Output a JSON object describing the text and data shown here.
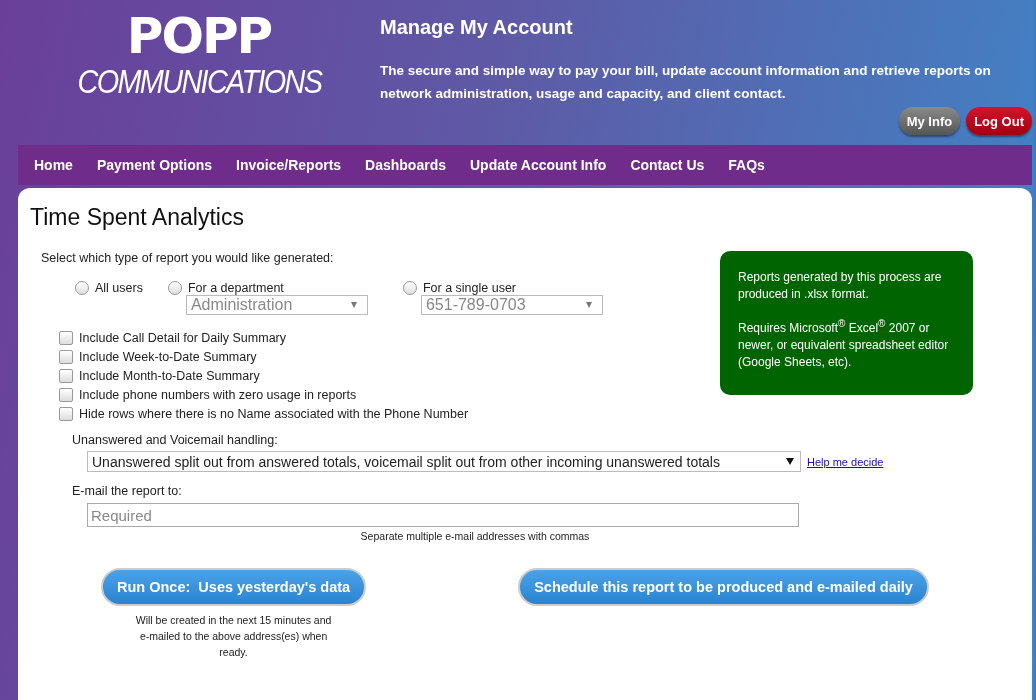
{
  "header": {
    "logo": {
      "wordmark": "POPP",
      "tagline": "COMMUNICATIONS"
    },
    "title": "Manage My Account",
    "description": "The secure and simple way to pay your bill, update account information and retrieve reports on network administration, usage and capacity, and client contact.",
    "buttons": [
      {
        "label": "My Info",
        "kind": "neutral"
      },
      {
        "label": "Log Out",
        "kind": "danger"
      }
    ]
  },
  "nav": {
    "items": [
      {
        "label": "Home"
      },
      {
        "label": "Payment Options"
      },
      {
        "label": "Invoice/Reports"
      },
      {
        "label": "Dashboards"
      },
      {
        "label": "Update Account Info"
      },
      {
        "label": "Contact Us"
      },
      {
        "label": "FAQs"
      }
    ]
  },
  "page": {
    "title": "Time Spent Analytics",
    "report_type": {
      "prompt": "Select which type of report you would like generated:",
      "options": [
        {
          "label": "All users",
          "selected": false
        },
        {
          "label": "For a department",
          "selected": false,
          "dropdown": {
            "value": "Administration",
            "disabled": true
          }
        },
        {
          "label": "For a single user",
          "selected": false,
          "dropdown": {
            "value": "651-789-0703",
            "disabled": true
          }
        }
      ]
    },
    "checkboxes": [
      {
        "label": "Include Call Detail for Daily Summary",
        "checked": false
      },
      {
        "label": "Include Week-to-Date Summary",
        "checked": false
      },
      {
        "label": "Include Month-to-Date Summary",
        "checked": false
      },
      {
        "label": "Include phone numbers with zero usage in reports",
        "checked": false
      },
      {
        "label": "Hide rows where there is no Name associated with the Phone Number",
        "checked": false
      }
    ],
    "info_box": {
      "paragraphs": [
        "Reports generated by this process are produced in .xlsx format.",
        "Requires Microsoft$^{®}$ Excel$^{®}$ 2007 or newer, or equivalent spreadsheet editor (Google Sheets, etc)."
      ]
    },
    "handling": {
      "label": "Unanswered and Voicemail handling:",
      "value": "Unanswered split out from answered totals, voicemail split out from other incoming unanswered totals",
      "help_link": "Help me decide"
    },
    "email": {
      "label": "E-mail the report to:",
      "placeholder": "Required",
      "hint": "Separate multiple e-mail addresses with commas"
    },
    "actions": [
      {
        "label": "Run Once:  Uses yesterday's data",
        "note": "Will be created in the next 15 minutes and e-mailed to the above address(es) when ready."
      },
      {
        "label": "Schedule this report to be produced and e-mailed daily"
      }
    ]
  }
}
